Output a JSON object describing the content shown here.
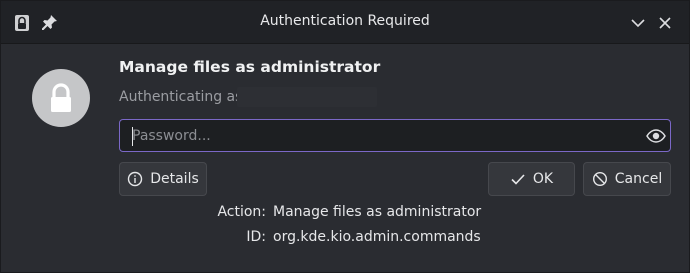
{
  "window": {
    "title": "Authentication Required"
  },
  "dialog": {
    "heading": "Manage files as administrator",
    "authenticating_as": "Authenticating as"
  },
  "password": {
    "placeholder": "Password...",
    "value": ""
  },
  "buttons": {
    "details": "Details",
    "ok": "OK",
    "cancel": "Cancel"
  },
  "details": {
    "action_label": "Action:",
    "action_value": "Manage files as administrator",
    "id_label": "ID:",
    "id_value": "org.kde.kio.admin.commands"
  },
  "colors": {
    "window_bg": "#2a2c31",
    "titlebar_bg": "#202226",
    "focus_border": "#7b68c7",
    "button_bg": "#35373c"
  },
  "icons": {
    "titlebar_left": [
      "lock-icon",
      "pin-icon"
    ],
    "titlebar_right": [
      "chevron-down-icon",
      "close-icon"
    ],
    "avatar": "lock-icon",
    "password_action": "eye-icon",
    "details": "info-icon",
    "ok": "check-icon",
    "cancel": "cancel-icon"
  }
}
